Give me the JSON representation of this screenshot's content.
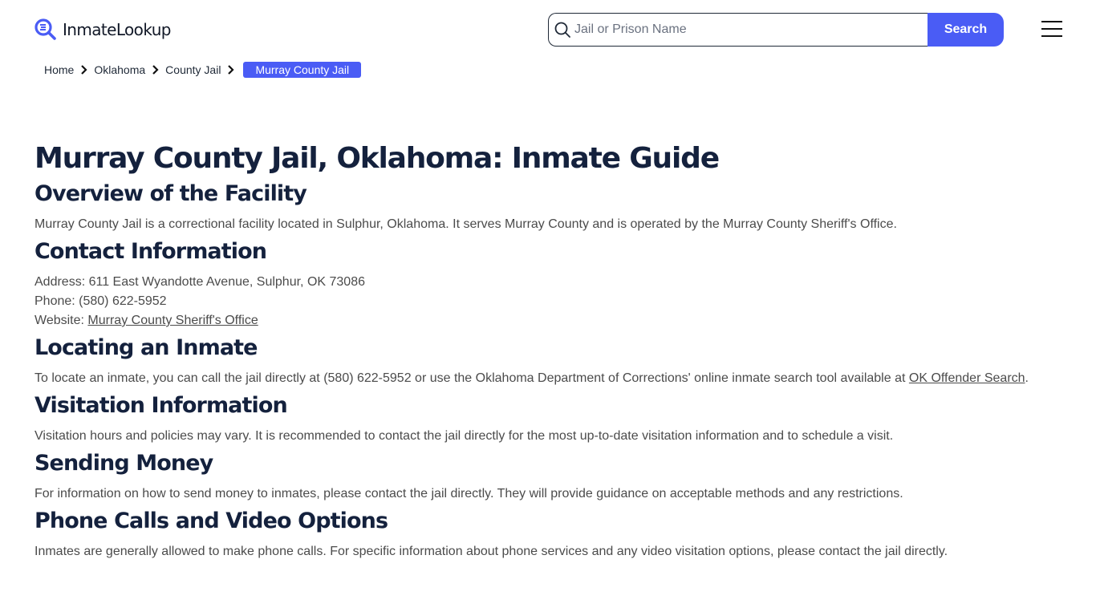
{
  "brand": {
    "name": "InmateLookup",
    "accent": "#4a5cf5",
    "heading_color": "#14213d"
  },
  "search": {
    "placeholder": "Jail or Prison Name",
    "value": "",
    "button_label": "Search"
  },
  "breadcrumb": [
    {
      "label": "Home"
    },
    {
      "label": "Oklahoma"
    },
    {
      "label": "County Jail"
    },
    {
      "label": "Murray County Jail",
      "active": true
    }
  ],
  "page": {
    "title": "Murray County Jail, Oklahoma: Inmate Guide",
    "sections": {
      "overview": {
        "heading": "Overview of the Facility",
        "text": "Murray County Jail is a correctional facility located in Sulphur, Oklahoma. It serves Murray County and is operated by the Murray County Sheriff's Office."
      },
      "contact": {
        "heading": "Contact Information",
        "address_label": "Address: ",
        "address": "611 East Wyandotte Avenue, Sulphur, OK 73086",
        "phone_label": "Phone: ",
        "phone": "(580) 622-5952",
        "website_label": "Website: ",
        "website_link": "Murray County Sheriff's Office"
      },
      "locating": {
        "heading": "Locating an Inmate",
        "text": "To locate an inmate, you can call the jail directly at (580) 622-5952 or use the Oklahoma Department of Corrections' online inmate search tool available at ",
        "link": "OK Offender Search",
        "suffix": "."
      },
      "visitation": {
        "heading": "Visitation Information",
        "text": "Visitation hours and policies may vary. It is recommended to contact the jail directly for the most up-to-date visitation information and to schedule a visit."
      },
      "money": {
        "heading": "Sending Money",
        "text": "For information on how to send money to inmates, please contact the jail directly. They will provide guidance on acceptable methods and any restrictions."
      },
      "phone_video": {
        "heading": "Phone Calls and Video Options",
        "text": "Inmates are generally allowed to make phone calls. For specific information about phone services and any video visitation options, please contact the jail directly."
      }
    }
  }
}
